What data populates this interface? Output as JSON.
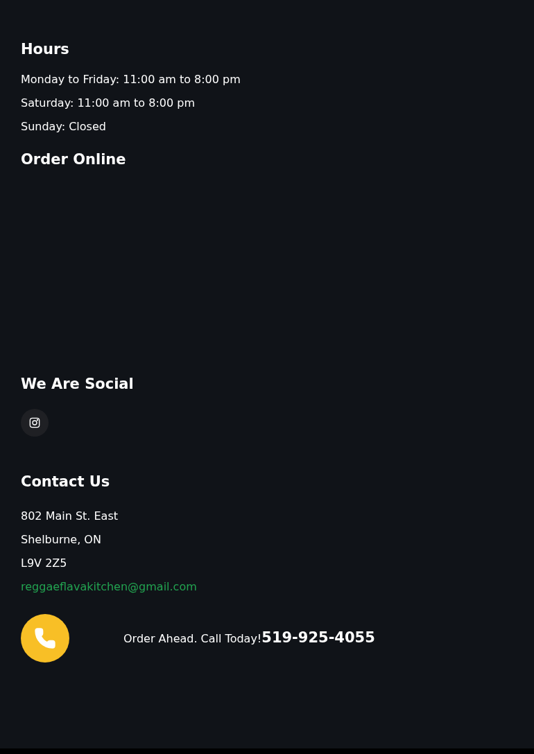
{
  "hours": {
    "title": "Hours",
    "lines": [
      "Monday to Friday: 11:00 am to 8:00 pm",
      "Saturday: 11:00 am to 8:00 pm",
      "Sunday: Closed"
    ]
  },
  "order_online": {
    "title": "Order Online"
  },
  "social": {
    "title": "We Are Social"
  },
  "contact": {
    "title": "Contact Us",
    "address": [
      "802 Main St. East",
      "Shelburne, ON",
      "L9V 2Z5"
    ],
    "email": "reggaeflavakitchen@gmail.com"
  },
  "call": {
    "text": "Order Ahead. Call Today!",
    "phone": "519-925-4055"
  }
}
